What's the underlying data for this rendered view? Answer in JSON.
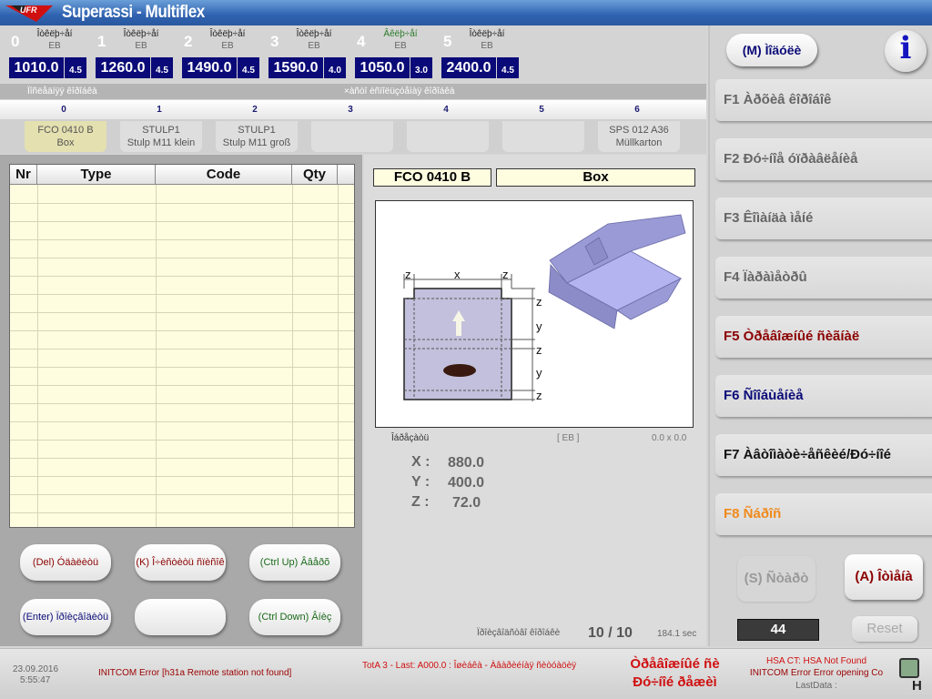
{
  "app": {
    "title": "Superassi - Multiflex",
    "logo_text": "UFR"
  },
  "stations": [
    {
      "num": "0",
      "type": "Îòêëþ÷åí",
      "unit": "EB",
      "value": "1010.0",
      "sub": "4.5",
      "type_color": "#222"
    },
    {
      "num": "1",
      "type": "Îòêëþ÷åí",
      "unit": "EB",
      "value": "1260.0",
      "sub": "4.5",
      "type_color": "#222"
    },
    {
      "num": "2",
      "type": "Îòêëþ÷åí",
      "unit": "EB",
      "value": "1490.0",
      "sub": "4.5",
      "type_color": "#222"
    },
    {
      "num": "3",
      "type": "Îòêëþ÷åí",
      "unit": "EB",
      "value": "1590.0",
      "sub": "4.0",
      "type_color": "#222"
    },
    {
      "num": "4",
      "type": "Âêëþ÷åí",
      "unit": "EB",
      "value": "1050.0",
      "sub": "3.0",
      "type_color": "#2a7a2a"
    },
    {
      "num": "5",
      "type": "Îòêëþ÷åí",
      "unit": "EB",
      "value": "2400.0",
      "sub": "4.5",
      "type_color": "#222"
    }
  ],
  "strip": {
    "left_label": "Ïîñëåäíÿÿ êîðîáêà",
    "right_label": "×àñòî èñïîëüçóåìàÿ êîðîáêà"
  },
  "slots": [
    {
      "num": "0",
      "line1": "FCO 0410 B",
      "line2": "Box"
    },
    {
      "num": "1",
      "line1": "STULP1",
      "line2": "Stulp M11 klein"
    },
    {
      "num": "2",
      "line1": "STULP1",
      "line2": "Stulp M11 groß"
    },
    {
      "num": "3",
      "line1": "",
      "line2": ""
    },
    {
      "num": "4",
      "line1": "",
      "line2": ""
    },
    {
      "num": "5",
      "line1": "",
      "line2": ""
    },
    {
      "num": "6",
      "line1": "SPS 012 A36",
      "line2": "Müllkarton"
    }
  ],
  "table": {
    "headers": [
      "Nr",
      "Type",
      "Code",
      "Qty"
    ],
    "rows": []
  },
  "buttons": {
    "delete": "(Del) Óäàëèòü",
    "clear": "(K) Î÷èñòèòü ñïèñîê",
    "up": "(Ctrl Up) Ââåðõ",
    "enter": "(Enter) Ïðîèçâîäèòü",
    "blank": "",
    "down": "(Ctrl Down) Âíèç"
  },
  "product": {
    "code": "FCO 0410 B",
    "name": "Box",
    "label": "Îáðåçàòü",
    "unit": "[ EB ]",
    "size": "0.0 x 0.0",
    "x_label": "X :",
    "x": "880.0",
    "y_label": "Y :",
    "y": "400.0",
    "z_label": "Z :",
    "z": "72.0",
    "diagram": {
      "top_labels": [
        "z",
        "x",
        "z"
      ],
      "side_labels": [
        "z",
        "y",
        "z",
        "y",
        "z"
      ]
    }
  },
  "progress": {
    "label": "Ïðîèçâîäñòâî êîðîáêè",
    "count": "10 / 10",
    "time": "184.1 sec"
  },
  "right": {
    "menu": "(M) Ìîäóëè",
    "info": "i",
    "fkeys": [
      {
        "label": "F1  Àðõèâ êîðîáîê",
        "color": "#666"
      },
      {
        "label": "F2  Ðó÷íîå óïðàâëåíèå",
        "color": "#666"
      },
      {
        "label": "F3  Êîìàíäà ìåíé",
        "color": "#666"
      },
      {
        "label": "F4  Ïàðàìåòðû",
        "color": "#666"
      },
      {
        "label": "F5  Òðåâîæíûé ñèãíàë",
        "color": "#8b0000"
      },
      {
        "label": "F6  Ñîîáùåíèå",
        "color": "#0a0a78"
      },
      {
        "label": "F7  Àâòîìàòè÷åñêèé/Ðó÷íîé",
        "color": "#111"
      },
      {
        "label": "F8  Ñáðîñ",
        "color": "#f08a1c"
      }
    ],
    "start": "(S) Ñòàðò",
    "cancel": "(A)  Îòìåíà",
    "counter": "44",
    "reset": "Reset"
  },
  "status": {
    "date": "23.09.2016",
    "time": "5:55:47",
    "error1": "INITCOM Error [h31a Remote station not found]",
    "tota": "TotA 3 - Last: A000.0 : Îøèáêà - Àâàðèéíàÿ ñèòóàöèÿ",
    "alarm1": "Òðåâîæíûé ñè",
    "alarm2": "Ðó÷íîé ðåæèì",
    "hsa1": "HSA CT: HSA Not Found",
    "hsa2": "INITCOM Error Error opening Co",
    "lastdata": "LastData :",
    "corner": "H"
  }
}
